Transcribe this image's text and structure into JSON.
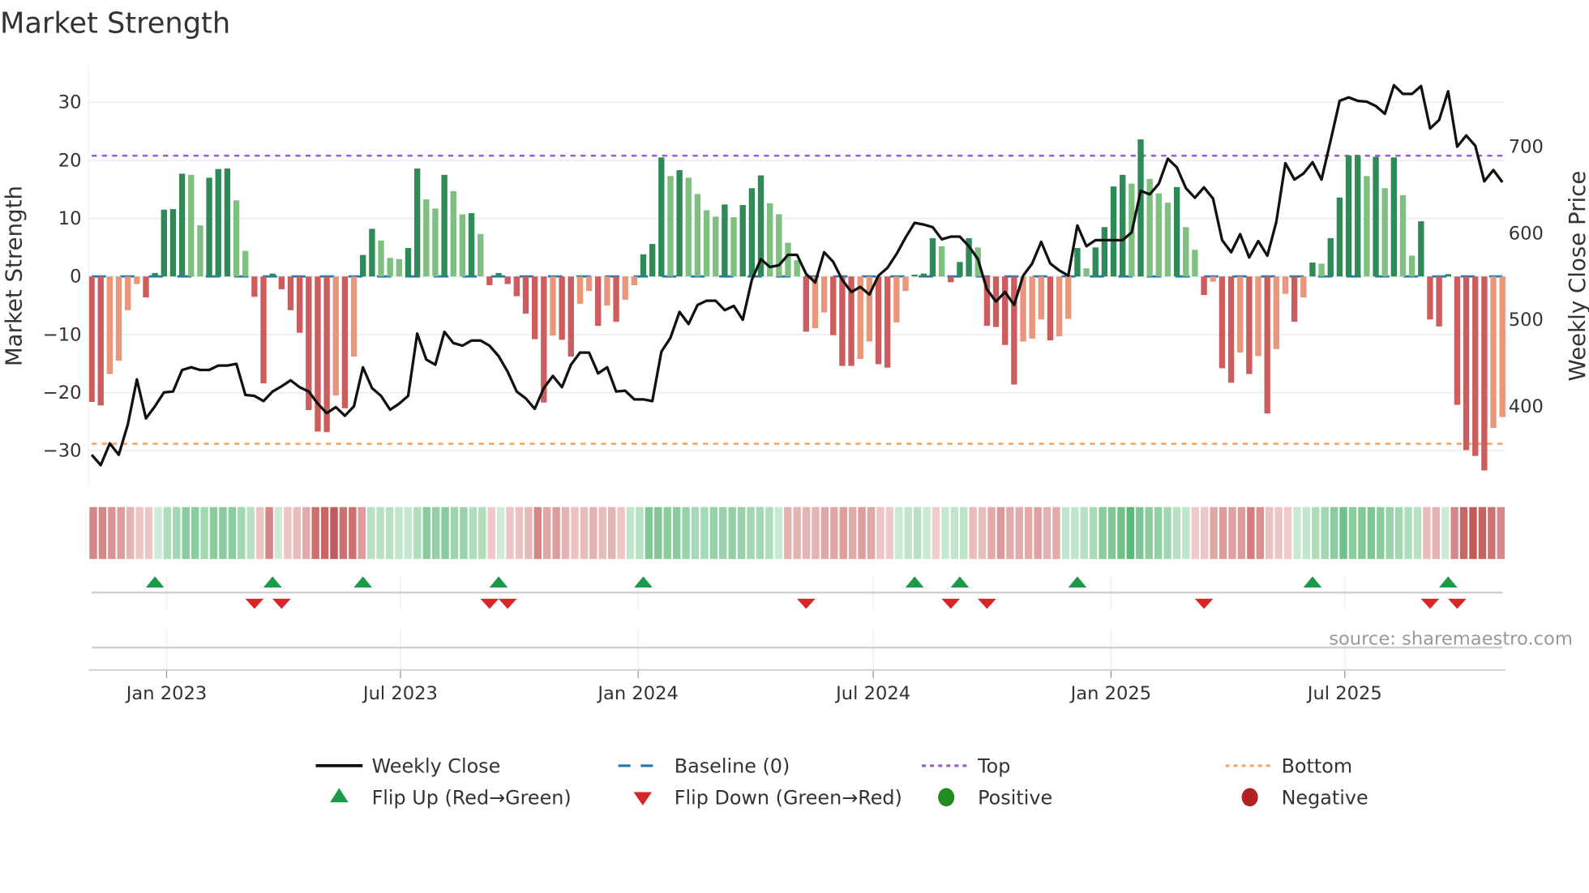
{
  "chart_data": {
    "type": "bar",
    "title": "Market Strength",
    "ylabel": "Market Strength",
    "y2label": "Weekly Close Price",
    "ylim": [
      -36.2,
      36.2
    ],
    "y2lim": [
      307,
      793
    ],
    "yticks": [
      -30,
      -20,
      -10,
      0,
      10,
      20,
      30
    ],
    "yticklabels": [
      "−30",
      "−20",
      "−10",
      "0",
      "10",
      "20",
      "30"
    ],
    "y2ticks": [
      400,
      500,
      600,
      700
    ],
    "y2ticklabels": [
      "400",
      "500",
      "600",
      "700"
    ],
    "x_start": "2022-11-04",
    "x_step_days": 7,
    "xticks": [
      {
        "date": "2023-01-01",
        "label": "Jan 2023"
      },
      {
        "date": "2023-07-01",
        "label": "Jul 2023"
      },
      {
        "date": "2024-01-01",
        "label": "Jan 2024"
      },
      {
        "date": "2024-07-01",
        "label": "Jul 2024"
      },
      {
        "date": "2025-01-01",
        "label": "Jan 2025"
      },
      {
        "date": "2025-07-01",
        "label": "Jul 2025"
      }
    ],
    "top_level": 20.8,
    "bottom_level": -28.8,
    "grid": true,
    "strength": [
      -21.6,
      -22.2,
      -16.8,
      -14.5,
      -5.8,
      -1.3,
      -3.6,
      0.6,
      11.5,
      11.6,
      17.7,
      17.5,
      8.8,
      17,
      18.5,
      18.6,
      13.1,
      4.4,
      -3.5,
      -18.4,
      0.5,
      -2.2,
      -5.8,
      -9.7,
      -23,
      -26.7,
      -26.8,
      -20.5,
      -22.7,
      -13.8,
      3.7,
      8.2,
      6.2,
      3.2,
      3,
      4.9,
      18.6,
      13.3,
      11.7,
      17.5,
      14.7,
      10.7,
      10.9,
      7.3,
      -1.5,
      0.6,
      -1.3,
      -3.4,
      -6.4,
      -10.8,
      -21.7,
      -10.2,
      -10.9,
      -13.8,
      -4.7,
      -2.5,
      -8.5,
      -5,
      -7.8,
      -4,
      -1.5,
      3.8,
      5.6,
      20.5,
      17.3,
      18.3,
      17,
      14.2,
      11.4,
      10.3,
      12.4,
      10.2,
      12.3,
      15.2,
      17.4,
      12.6,
      10.7,
      5.8,
      2.8,
      -9.5,
      -8.9,
      -6.2,
      -10.1,
      -15.4,
      -15.4,
      -14.2,
      -11.2,
      -15.1,
      -15.7,
      -7.9,
      -2.5,
      0.3,
      0.5,
      6.6,
      5.2,
      -1,
      2.5,
      6.6,
      5,
      -8.5,
      -8.7,
      -11.8,
      -18.6,
      -11.2,
      -10.7,
      -7.4,
      -11,
      -10.3,
      -7.3,
      4.9,
      1.4,
      5,
      8.5,
      15.5,
      17.5,
      16,
      23.6,
      16.8,
      14.3,
      12.7,
      15.4,
      8.5,
      4.6,
      -3.2,
      -0.9,
      -15.8,
      -18.3,
      -13.1,
      -16.8,
      -13.7,
      -23.6,
      -12.5,
      -3,
      -7.8,
      -3.6,
      2.4,
      2.2,
      6.6,
      13.6,
      20.8,
      20.8,
      17.3,
      20.6,
      15.2,
      20.5,
      14,
      3.6,
      9.5,
      -7.4,
      -8.6,
      0.4,
      -22.1,
      -29.9,
      -30.9,
      -33.4,
      -26.1,
      -24.2
    ],
    "weekly_close": [
      344,
      332,
      357,
      344,
      379,
      431,
      386,
      400,
      416,
      417,
      442,
      445,
      442,
      442,
      447,
      447,
      449,
      413,
      412,
      406,
      417,
      423,
      430,
      422,
      417,
      403,
      392,
      399,
      389,
      400,
      445,
      421,
      412,
      396,
      403,
      412,
      484,
      454,
      448,
      486,
      473,
      470,
      476,
      476,
      470,
      458,
      440,
      417,
      409,
      397,
      421,
      435,
      422,
      448,
      462,
      462,
      438,
      445,
      417,
      418,
      408,
      408,
      406,
      463,
      479,
      509,
      495,
      517,
      522,
      522,
      511,
      516,
      500,
      546,
      570,
      561,
      563,
      575,
      575,
      553,
      543,
      578,
      567,
      546,
      532,
      538,
      529,
      551,
      560,
      576,
      595,
      612,
      610,
      607,
      593,
      596,
      596,
      585,
      570,
      535,
      521,
      532,
      517,
      551,
      565,
      590,
      565,
      557,
      551,
      609,
      585,
      592,
      592,
      592,
      592,
      601,
      649,
      645,
      657,
      686,
      676,
      652,
      641,
      653,
      640,
      592,
      578,
      599,
      572,
      591,
      574,
      613,
      681,
      662,
      669,
      682,
      662,
      707,
      753,
      757,
      753,
      752,
      747,
      738,
      771,
      761,
      761,
      770,
      721,
      731,
      764,
      700,
      713,
      701,
      660,
      673,
      659
    ],
    "regime_strip": [
      -2,
      -2,
      -1.7,
      -1.5,
      -1,
      -0.6,
      -0.6,
      0.5,
      1.2,
      1.5,
      2,
      2,
      1.5,
      2,
      2,
      2,
      1.5,
      1,
      -0.6,
      -2,
      0.5,
      -0.6,
      -0.8,
      -1.2,
      -2.5,
      -2.7,
      -3,
      -2.5,
      -2.5,
      -1.5,
      1,
      1,
      1,
      0.8,
      0.7,
      1.2,
      2,
      1.8,
      2,
      1.6,
      1.7,
      1.2,
      1.2,
      -0.5,
      0.5,
      -0.6,
      -0.7,
      -0.9,
      -2,
      -1.3,
      -1.5,
      -1,
      -0.7,
      -0.8,
      -1,
      -0.8,
      -1,
      -0.6,
      0.8,
      1,
      2.2,
      2.2,
      2,
      2,
      1.7,
      1.4,
      1.4,
      1.7,
      1.7,
      1.8,
      1.7,
      1.5,
      1.5,
      1.2,
      0.6,
      -1,
      -1,
      -1,
      -1,
      -1.3,
      -1.3,
      -1.5,
      -1.2,
      -1.5,
      -1.3,
      -0.6,
      -0.5,
      0.6,
      0.8,
      1,
      0.6,
      -0.4,
      0.7,
      0.8,
      0.9,
      -0.8,
      -0.8,
      -1.2,
      -1.6,
      -1.2,
      -1.2,
      -1.2,
      -1.4,
      -1,
      -1.2,
      0.8,
      0.8,
      1,
      1.3,
      2,
      2.2,
      2.5,
      3,
      2.3,
      2,
      1.8,
      1.5,
      1,
      0.8,
      -0.5,
      -0.6,
      -1.3,
      -1.5,
      -1.4,
      -1.5,
      -2.2,
      -1.8,
      -0.7,
      -0.6,
      -0.5,
      0.6,
      0.8,
      1.2,
      1.5,
      2,
      2.5,
      2,
      2.2,
      2.3,
      2,
      1.7,
      1.5,
      1.2,
      1,
      -0.8,
      -1,
      0.5,
      -2,
      -2.7,
      -3,
      -2.8,
      -2.5,
      -2
    ],
    "regime_strip_max": 3,
    "legend": {
      "placement": "bottom",
      "items": [
        {
          "label": "Weekly Close",
          "kind": "line"
        },
        {
          "label": "Baseline (0)",
          "kind": "dash"
        },
        {
          "label": "Top",
          "kind": "dot"
        },
        {
          "label": "Bottom",
          "kind": "dot"
        },
        {
          "label": "Flip Up (Red→Green)",
          "kind": "triangle-up"
        },
        {
          "label": "Flip Down (Green→Red)",
          "kind": "triangle-down"
        },
        {
          "label": "Positive",
          "kind": "circle"
        },
        {
          "label": "Negative",
          "kind": "circle"
        }
      ]
    },
    "source": "source: sharemaestro.com"
  },
  "colors": {
    "bar_pos_strong": "#2e8b57",
    "bar_pos_weak": "#7fbf7f",
    "bar_neg_strong": "#cd5c5c",
    "bar_neg_weak": "#e9967a",
    "close_line": "#111111",
    "baseline": "#1f77b4",
    "top": "#9b59d6",
    "bottom": "#f4a460",
    "flip_up": "#1a9a4a",
    "flip_down": "#d62728",
    "positive": "#228b22",
    "negative": "#b22222"
  }
}
